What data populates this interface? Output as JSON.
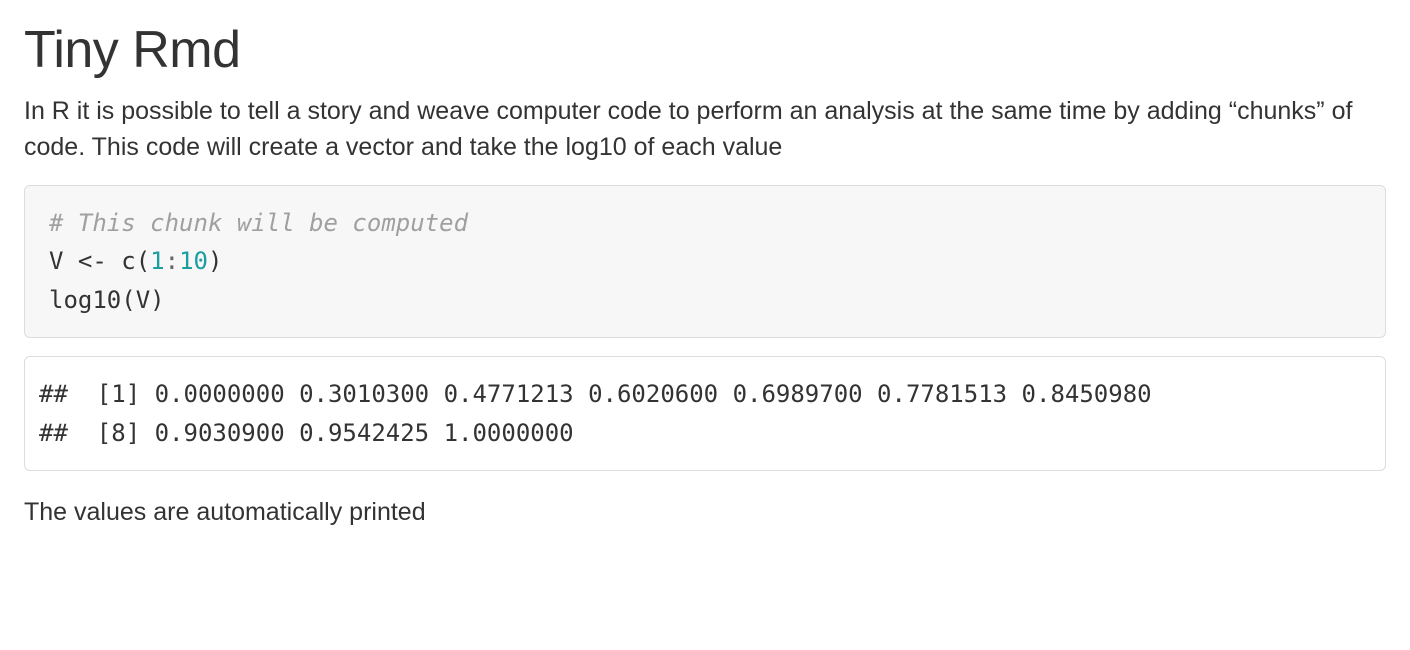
{
  "title": "Tiny Rmd",
  "intro": "In R it is possible to tell a story and weave computer code to perform an analysis at the same time by adding “chunks” of code. This code will create a vector and take the log10 of each value",
  "code": {
    "comment": "# This chunk will be computed",
    "line2_pre": "V <- c(",
    "line2_num1": "1",
    "line2_colon": ":",
    "line2_num2": "10",
    "line2_post": ")",
    "line3": "log10(V)"
  },
  "output": "##  [1] 0.0000000 0.3010300 0.4771213 0.6020600 0.6989700 0.7781513 0.8450980\n##  [8] 0.9030900 0.9542425 1.0000000",
  "closing": "The values are automatically printed"
}
